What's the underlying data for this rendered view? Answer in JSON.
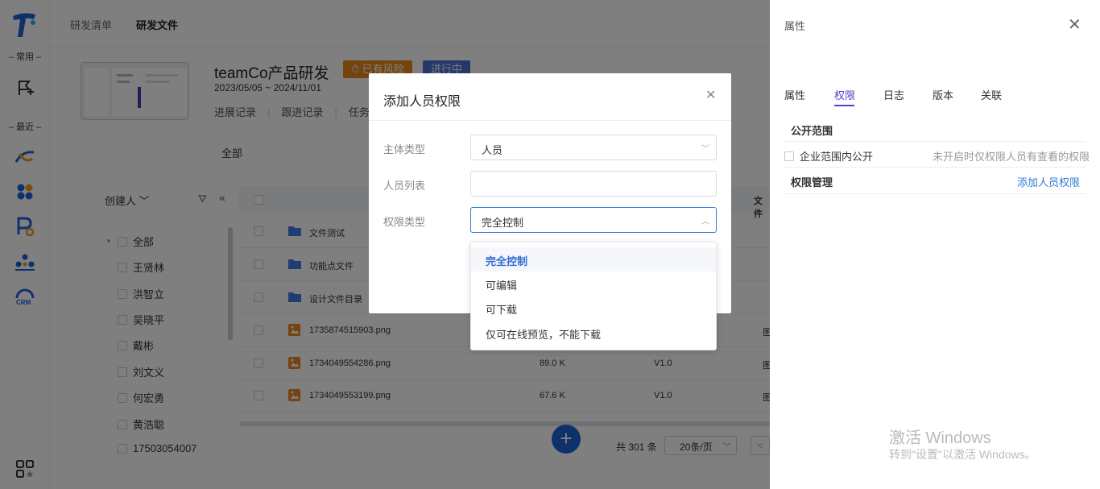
{
  "rail": {
    "section_common": "– 常用 –",
    "section_recent": "– 最近 –"
  },
  "topnav": {
    "tabs": [
      "研发清单",
      "研发文件"
    ]
  },
  "project": {
    "title": "teamCo产品研发",
    "badge_risk": "⏱ 已有风险",
    "badge_status": "进行中",
    "date": "2023/05/05 ~ 2024/11/01",
    "links": [
      "进展记录",
      "跟进记录",
      "任务"
    ]
  },
  "filter_all": "全部",
  "tree": {
    "header": "创建人",
    "items": [
      "全部",
      "王贤林",
      "洪智立",
      "吴晓平",
      "戴彬",
      "刘文义",
      "何宏勇",
      "黄浩聪",
      "17503054007"
    ]
  },
  "table": {
    "type_header": "文件",
    "rows": [
      {
        "name": "文件测试",
        "kind": "folder",
        "size": "",
        "version": "",
        "type": ""
      },
      {
        "name": "功能点文件",
        "kind": "folder",
        "size": "",
        "version": "",
        "type": ""
      },
      {
        "name": "设计文件目录",
        "kind": "folder",
        "size": "",
        "version": "",
        "type": ""
      },
      {
        "name": "1735874515903.png",
        "kind": "image",
        "size": "",
        "version": "",
        "type": "图"
      },
      {
        "name": "1734049554286.png",
        "kind": "image",
        "size": "89.0 K",
        "version": "V1.0",
        "type": "图"
      },
      {
        "name": "1734049553199.png",
        "kind": "image",
        "size": "67.6 K",
        "version": "V1.0",
        "type": "图"
      }
    ]
  },
  "pagination": {
    "total": "共 301 条",
    "page_size": "20条/页",
    "prev": "<"
  },
  "panel": {
    "title": "属性",
    "tabs": [
      "属性",
      "权限",
      "日志",
      "版本",
      "关联"
    ],
    "public_section": "公开范围",
    "public_option": "企业范围内公开",
    "public_hint": "未开启时仅权限人员有查看的权限",
    "perm_section": "权限管理",
    "add_link": "添加人员权限",
    "watermark_title": "激活 Windows",
    "watermark_sub": "转到\"设置\"以激活 Windows。"
  },
  "modal": {
    "title": "添加人员权限",
    "subject_label": "主体类型",
    "subject_value": "人员",
    "people_label": "人员列表",
    "people_value": "",
    "perm_label": "权限类型",
    "perm_value": "完全控制"
  },
  "dropdown": {
    "options": [
      "完全控制",
      "可编辑",
      "可下载",
      "仅可在线预览，不能下载"
    ],
    "selected_index": 0
  },
  "colors": {
    "accent": "#2f7bd6",
    "risk": "#e8891d",
    "status": "#4b6fd8",
    "panel_tab": "#5a3ec8",
    "fab": "#1e63d6"
  }
}
